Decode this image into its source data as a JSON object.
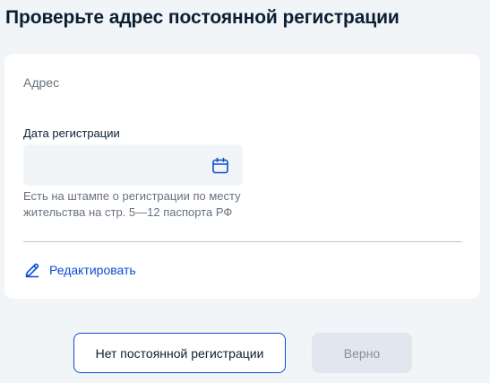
{
  "page": {
    "title": "Проверьте адрес постоянной регистрации"
  },
  "card": {
    "address_label": "Адрес",
    "date_field": {
      "label": "Дата регистрации",
      "value": "",
      "icon": "calendar-icon"
    },
    "hint": "Есть на штампе о регистрации по месту жительства на стр. 5—12 паспорта РФ",
    "edit": {
      "label": "Редактировать",
      "icon": "pencil-icon"
    }
  },
  "actions": {
    "no_registration_label": "Нет постоянной регистрации",
    "correct_label": "Верно",
    "correct_disabled": true
  },
  "colors": {
    "accent": "#0d4cd3",
    "background": "#f2f5f8",
    "text": "#0b1f33",
    "muted_text": "#66727f",
    "disabled_button": "#e1e6ef"
  }
}
